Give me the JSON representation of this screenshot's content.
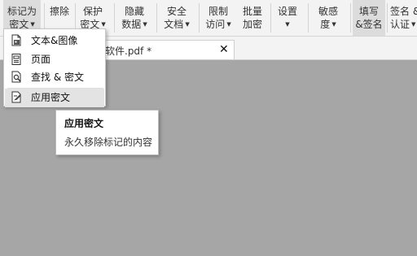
{
  "ribbon": {
    "buttons": [
      {
        "line1": "标记为",
        "line2": "密文"
      },
      {
        "line1": "擦除",
        "line2": ""
      },
      {
        "line1": "保护",
        "line2": "密文"
      },
      {
        "line1": "隐藏",
        "line2": "数据"
      },
      {
        "line1": "安全",
        "line2": "文档"
      },
      {
        "line1": "限制",
        "line2": "访问"
      },
      {
        "line1": "批量",
        "line2": "加密"
      },
      {
        "line1": "设置",
        "line2": ""
      },
      {
        "line1": "敏感",
        "line2": "度"
      },
      {
        "line1": "填写",
        "line2": "&签名"
      },
      {
        "line1": "签名 &",
        "line2": "认证"
      }
    ]
  },
  "document_tab": {
    "title": "软件.pdf *",
    "close_glyph": "✕"
  },
  "dropdown_menu": {
    "items": [
      {
        "label": "文本&图像",
        "icon": "text-image-icon"
      },
      {
        "label": "页面",
        "icon": "page-icon"
      },
      {
        "label": "查找 & 密文",
        "icon": "search-redact-icon"
      },
      {
        "label": "应用密文",
        "icon": "apply-redaction-icon"
      }
    ]
  },
  "tooltip": {
    "title": "应用密文",
    "description": "永久移除标记的内容"
  },
  "colors": {
    "workspace": "#a6a6a6",
    "ribbon": "#f3f3f3",
    "menu_hover": "#e3e3e3"
  }
}
